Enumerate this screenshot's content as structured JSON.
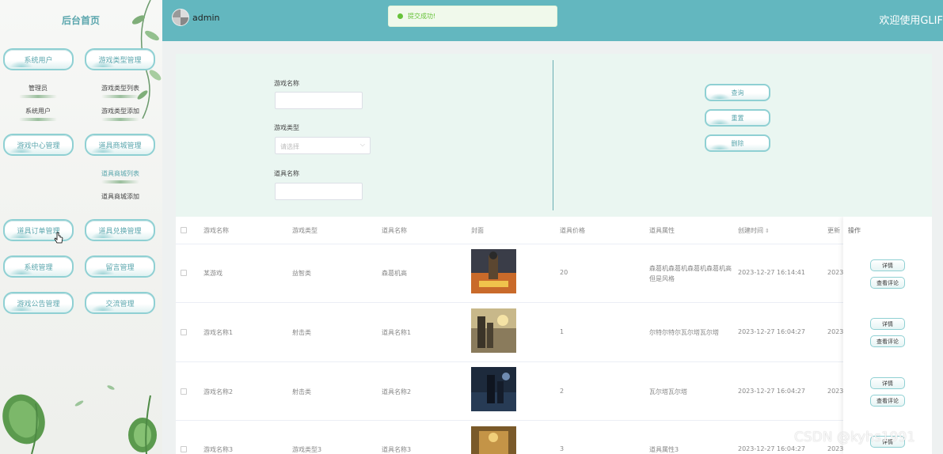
{
  "sidebar": {
    "title": "后台首页",
    "menus": [
      {
        "label": "系统用户"
      },
      {
        "label": "游戏类型管理"
      },
      {
        "label": "游戏中心管理"
      },
      {
        "label": "道具商城管理"
      },
      {
        "label": "道具订单管理"
      },
      {
        "label": "道具兑换管理"
      },
      {
        "label": "系统管理"
      },
      {
        "label": "留言管理"
      },
      {
        "label": "游戏公告管理"
      },
      {
        "label": "交流管理"
      }
    ],
    "subs": [
      {
        "label": "管理员"
      },
      {
        "label": "系统用户"
      },
      {
        "label": "游戏类型列表"
      },
      {
        "label": "游戏类型添加"
      },
      {
        "label": "道具商城列表"
      },
      {
        "label": "道具商城添加"
      }
    ]
  },
  "header": {
    "username": "admin",
    "toast": "提交成功!",
    "welcome": "欢迎使用GLIF"
  },
  "search": {
    "game_name_label": "游戏名称",
    "game_type_label": "游戏类型",
    "game_type_placeholder": "请选择",
    "item_name_label": "道具名称",
    "query_btn": "查询",
    "reset_btn": "重置",
    "delete_btn": "删除"
  },
  "table": {
    "headers": [
      "游戏名称",
      "游戏类型",
      "道具名称",
      "封面",
      "道具价格",
      "道具属性",
      "创建时间",
      "更新",
      "操作"
    ],
    "rows": [
      {
        "game": "某游戏",
        "type": "益智类",
        "item": "森葛机高",
        "price": "20",
        "attr": "森葛机森葛机森葛机森葛机高",
        "attr2": "但是风格",
        "created": "2023-12-27 16:14:41",
        "updated": "2023-"
      },
      {
        "game": "游戏名称1",
        "type": "射击类",
        "item": "道具名称1",
        "price": "1",
        "attr": "尔特尔特尔瓦尔塔瓦尔塔",
        "attr2": "",
        "created": "2023-12-27 16:04:27",
        "updated": "2023-"
      },
      {
        "game": "游戏名称2",
        "type": "射击类",
        "item": "道具名称2",
        "price": "2",
        "attr": "瓦尔塔瓦尔塔",
        "attr2": "",
        "created": "2023-12-27 16:04:27",
        "updated": "2023-"
      },
      {
        "game": "游戏名称3",
        "type": "游戏类型3",
        "item": "道具名称3",
        "price": "3",
        "attr": "道具属性3",
        "attr2": "",
        "created": "2023-12-27 16:04:27",
        "updated": "2023-"
      }
    ],
    "op_detail": "详情",
    "op_review": "查看评论"
  },
  "watermark": "CSDN @kyhs1991",
  "colors": {
    "header_bg": "#63b7bf",
    "accent": "#5aa6ad",
    "panel_bg": "#eaf6f1",
    "success": "#67c23a"
  },
  "icons": [
    "avatar-icon",
    "success-icon",
    "chevron-down-icon",
    "sort-icon"
  ]
}
